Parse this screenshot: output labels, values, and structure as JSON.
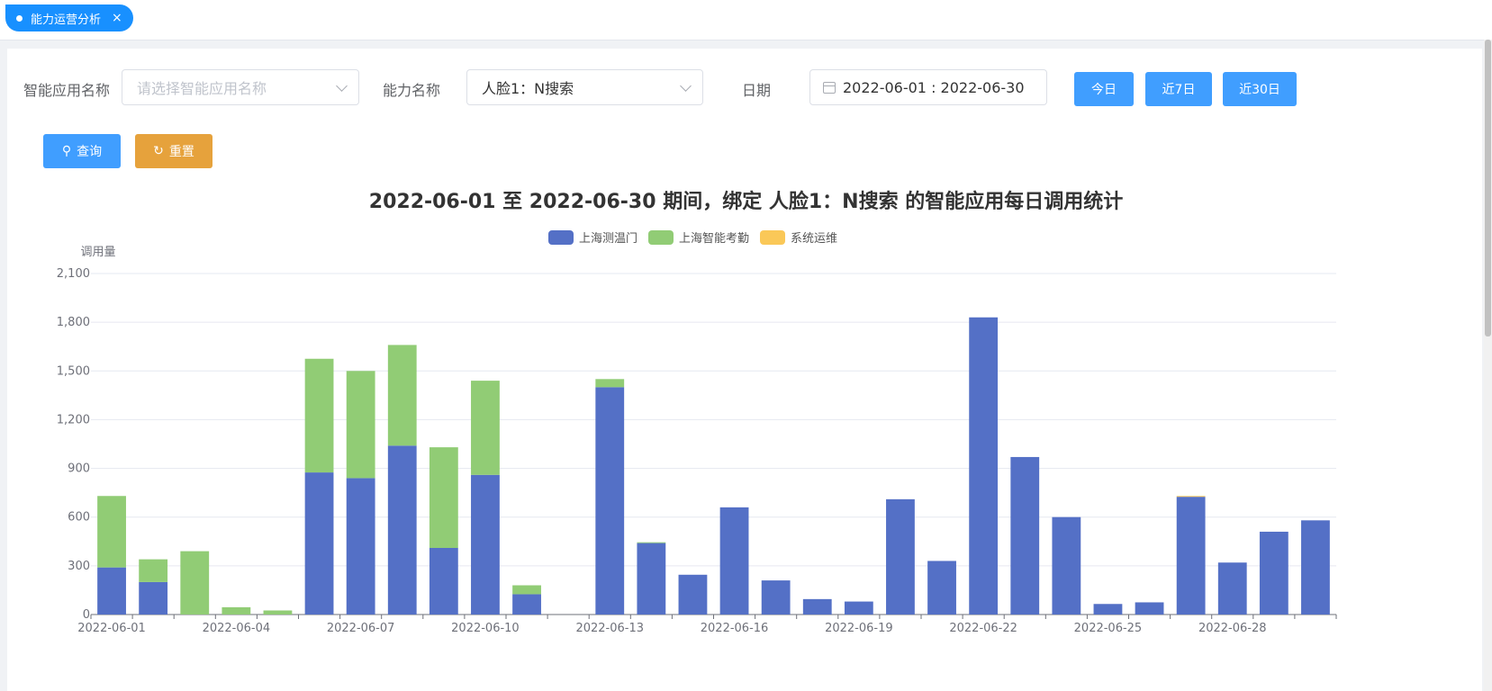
{
  "tab": {
    "label": "能力运营分析",
    "close": "×"
  },
  "filters": {
    "app_label": "智能应用名称",
    "app_placeholder": "请选择智能应用名称",
    "ability_label": "能力名称",
    "ability_value": "人脸1：N搜索",
    "date_label": "日期",
    "date_value": "2022-06-01 : 2022-06-30",
    "today_button": "今日",
    "last7_button": "近7日",
    "last30_button": "近30日",
    "search_button": "查询",
    "reset_button": "重置"
  },
  "colors": {
    "primary": "#409eff",
    "orange": "#e6a23c",
    "tab": "#1890ff"
  },
  "chart_data": {
    "type": "bar",
    "stacked": true,
    "title": "2022-06-01 至 2022-06-30 期间，绑定 人脸1：N搜索 的智能应用每日调用统计",
    "ylabel": "调用量",
    "ylim": [
      0,
      2100
    ],
    "yticks": [
      0,
      300,
      600,
      900,
      1200,
      1500,
      1800,
      2100
    ],
    "ytick_labels": [
      "0",
      "300",
      "600",
      "900",
      "1,200",
      "1,500",
      "1,800",
      "2,100"
    ],
    "x_tick_labels": [
      "2022-06-01",
      "2022-06-04",
      "2022-06-07",
      "2022-06-10",
      "2022-06-13",
      "2022-06-16",
      "2022-06-19",
      "2022-06-22",
      "2022-06-25",
      "2022-06-28"
    ],
    "categories": [
      "2022-06-01",
      "2022-06-02",
      "2022-06-03",
      "2022-06-04",
      "2022-06-05",
      "2022-06-06",
      "2022-06-07",
      "2022-06-08",
      "2022-06-09",
      "2022-06-10",
      "2022-06-11",
      "2022-06-12",
      "2022-06-13",
      "2022-06-14",
      "2022-06-15",
      "2022-06-16",
      "2022-06-17",
      "2022-06-18",
      "2022-06-19",
      "2022-06-20",
      "2022-06-21",
      "2022-06-22",
      "2022-06-23",
      "2022-06-24",
      "2022-06-25",
      "2022-06-26",
      "2022-06-27",
      "2022-06-28",
      "2022-06-29",
      "2022-06-30"
    ],
    "series": [
      {
        "name": "上海测温门",
        "color": "#5470c6",
        "values": [
          290,
          200,
          0,
          0,
          0,
          875,
          840,
          1040,
          410,
          860,
          125,
          0,
          1400,
          440,
          245,
          660,
          210,
          95,
          80,
          710,
          330,
          1830,
          970,
          600,
          65,
          75,
          725,
          320,
          510,
          580
        ]
      },
      {
        "name": "上海智能考勤",
        "color": "#91cc75",
        "values": [
          440,
          140,
          390,
          45,
          25,
          700,
          660,
          620,
          620,
          580,
          55,
          0,
          50,
          5,
          0,
          0,
          0,
          0,
          0,
          0,
          0,
          0,
          0,
          0,
          0,
          0,
          0,
          0,
          0,
          0
        ]
      },
      {
        "name": "系统运维",
        "color": "#fac858",
        "values": [
          0,
          0,
          0,
          0,
          0,
          0,
          0,
          0,
          0,
          0,
          0,
          0,
          0,
          0,
          0,
          0,
          0,
          0,
          0,
          0,
          0,
          0,
          0,
          0,
          0,
          0,
          5,
          0,
          0,
          0
        ]
      }
    ],
    "legend_position": "top-center",
    "grid": true
  }
}
